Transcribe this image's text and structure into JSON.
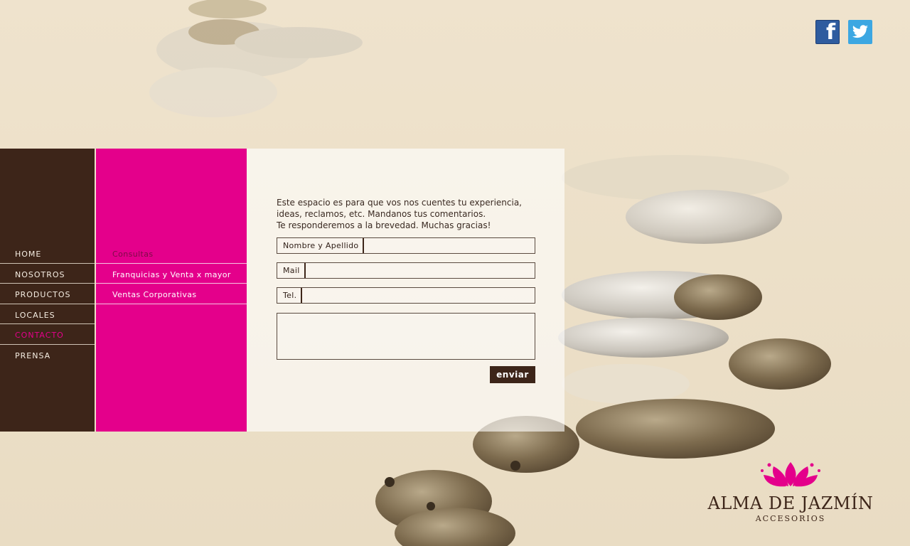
{
  "social": {
    "facebook_icon": "facebook-icon",
    "twitter_icon": "twitter-icon"
  },
  "nav": {
    "items": [
      {
        "label": "HOME"
      },
      {
        "label": "NOSOTROS"
      },
      {
        "label": "PRODUCTOS"
      },
      {
        "label": "LOCALES"
      },
      {
        "label": "CONTACTO",
        "active": true
      },
      {
        "label": "PRENSA"
      }
    ]
  },
  "subnav": {
    "items": [
      {
        "label": "Consultas",
        "active": true
      },
      {
        "label": "Franquicias y Venta x mayor"
      },
      {
        "label": "Ventas Corporativas"
      }
    ]
  },
  "form": {
    "intro": [
      "Este espacio es para que vos nos cuentes tu experiencia,",
      "ideas, reclamos, etc. Mandanos tus comentarios.",
      "Te responderemos a la brevedad. Muchas gracias!"
    ],
    "name_label": "Nombre y Apellido",
    "name_value": "",
    "mail_label": "Mail",
    "mail_value": "",
    "tel_label": "Tel.",
    "tel_value": "",
    "message_value": "",
    "submit_label": "enviar"
  },
  "logo": {
    "name": "ALMA DE JAZMÍN",
    "subtitle": "ACCESORIOS"
  },
  "colors": {
    "brown": "#3d2519",
    "magenta": "#e4008b",
    "cream": "#efe3cd"
  }
}
